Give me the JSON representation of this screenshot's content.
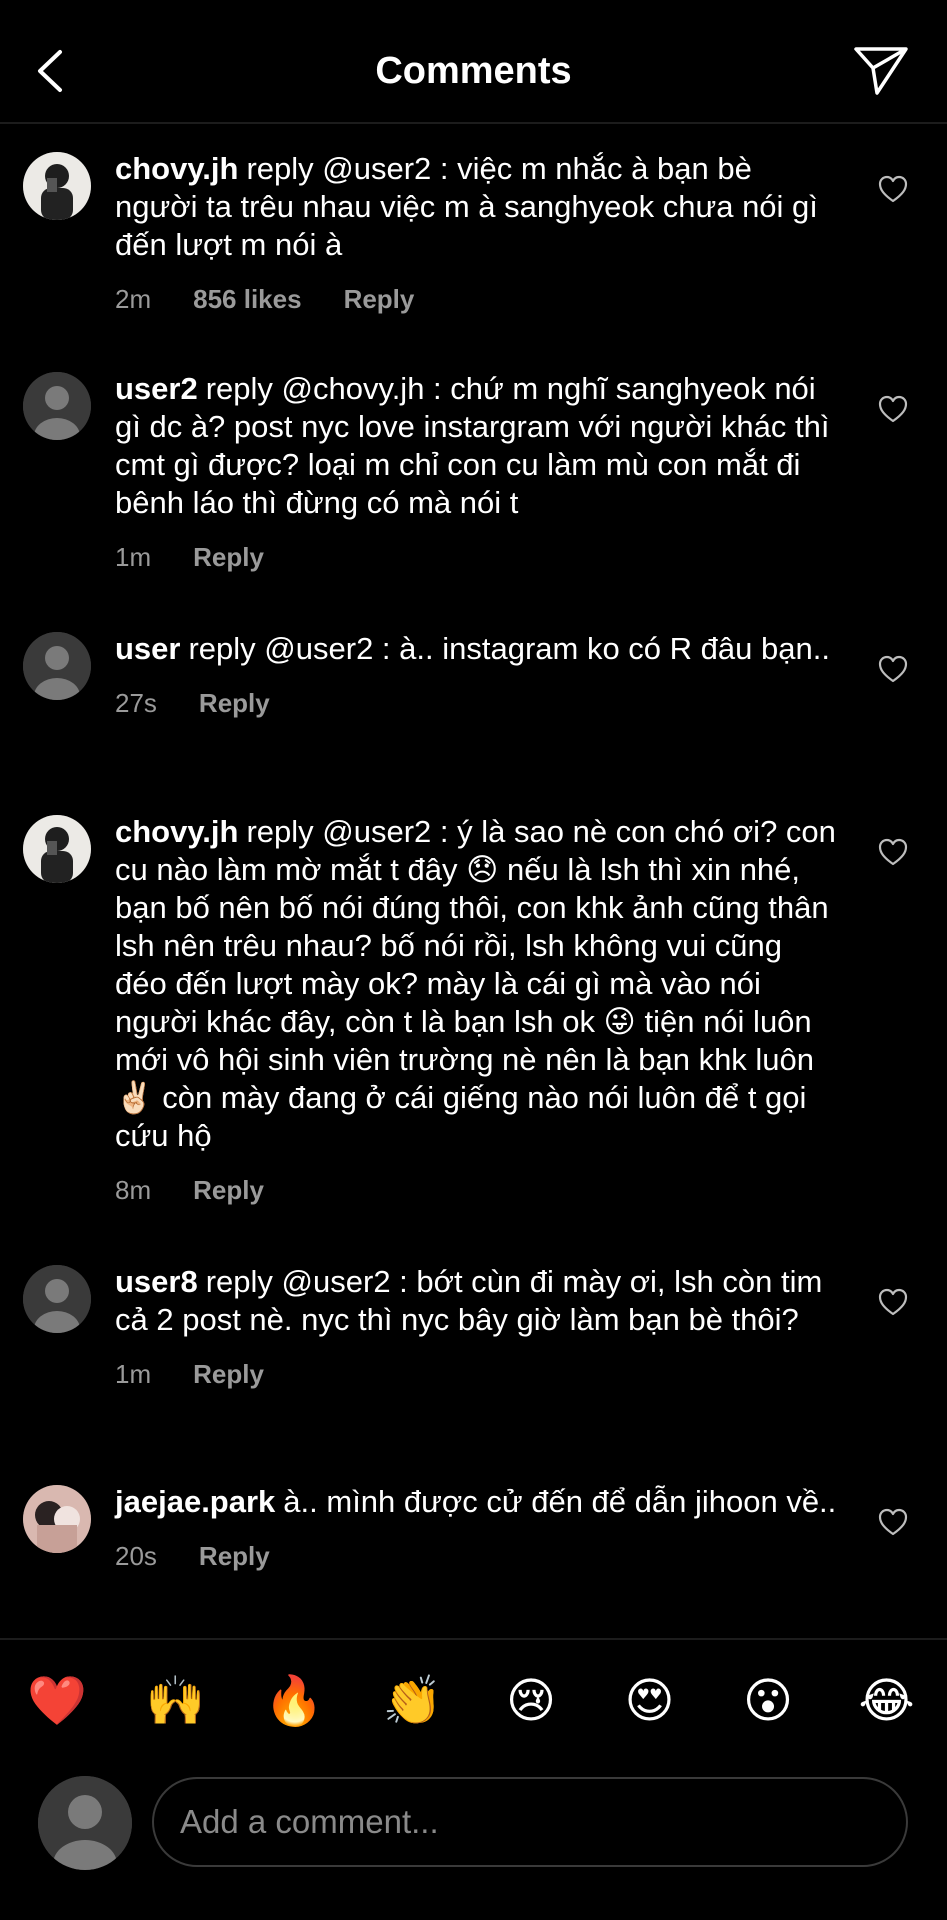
{
  "header": {
    "title": "Comments"
  },
  "comments": [
    {
      "username": "chovy.jh",
      "text": "reply @user2 : việc m nhắc à bạn bè người ta trêu nhau việc m à sanghyeok chưa nói gì đến lượt m nói à",
      "time": "2m",
      "likes": "856 likes",
      "reply": "Reply",
      "avatar": "photo-avatar"
    },
    {
      "username": "user2",
      "text": "reply @chovy.jh : chứ m nghĩ sanghyeok nói gì dc à? post nyc love instargram với người khác thì cmt gì được? loại m chỉ con cu làm mù con mắt đi bênh láo thì đừng có mà nói t",
      "time": "1m",
      "likes": "",
      "reply": "Reply",
      "avatar": "default-avatar"
    },
    {
      "username": "user",
      "text": "reply @user2 : à.. instagram ko có R đâu bạn..",
      "time": "27s",
      "likes": "",
      "reply": "Reply",
      "avatar": "default-avatar"
    },
    {
      "username": "chovy.jh",
      "text": "reply @user2 : ý là sao nè con chó ơi? con cu nào làm mờ mắt t đây 😞 nếu là lsh thì xin nhé, bạn bố nên bố nói đúng thôi, con khk ảnh cũng thân lsh nên trêu nhau? bố nói rồi, lsh không vui cũng đéo đến lượt mày ok? mày là cái gì mà vào nói người khác đây, còn t là bạn lsh ok 😜 tiện nói luôn mới vô hội sinh viên trường nè nên là bạn khk luôn ✌🏻 còn mày đang ở cái giếng nào nói luôn để t gọi cứu hộ",
      "time": "8m",
      "likes": "",
      "reply": "Reply",
      "avatar": "photo-avatar"
    },
    {
      "username": "user8",
      "text": "reply @user2 : bớt cùn đi mày ơi, lsh còn tim cả 2 post nè. nyc thì nyc bây giờ làm bạn bè thôi?",
      "time": "1m",
      "likes": "",
      "reply": "Reply",
      "avatar": "default-avatar"
    },
    {
      "username": "jaejae.park",
      "text": "à.. mình được cử đến để dẫn jihoon về..",
      "time": "20s",
      "likes": "",
      "reply": "Reply",
      "avatar": "photo-avatar-pink"
    }
  ],
  "emoji_bar": [
    "❤️",
    "🙌",
    "🔥",
    "👏",
    "😢",
    "😍",
    "😮",
    "😂"
  ],
  "composer": {
    "placeholder": "Add a comment..."
  },
  "colors": {
    "background": "#000000",
    "secondary_text": "#9a9a9a"
  }
}
